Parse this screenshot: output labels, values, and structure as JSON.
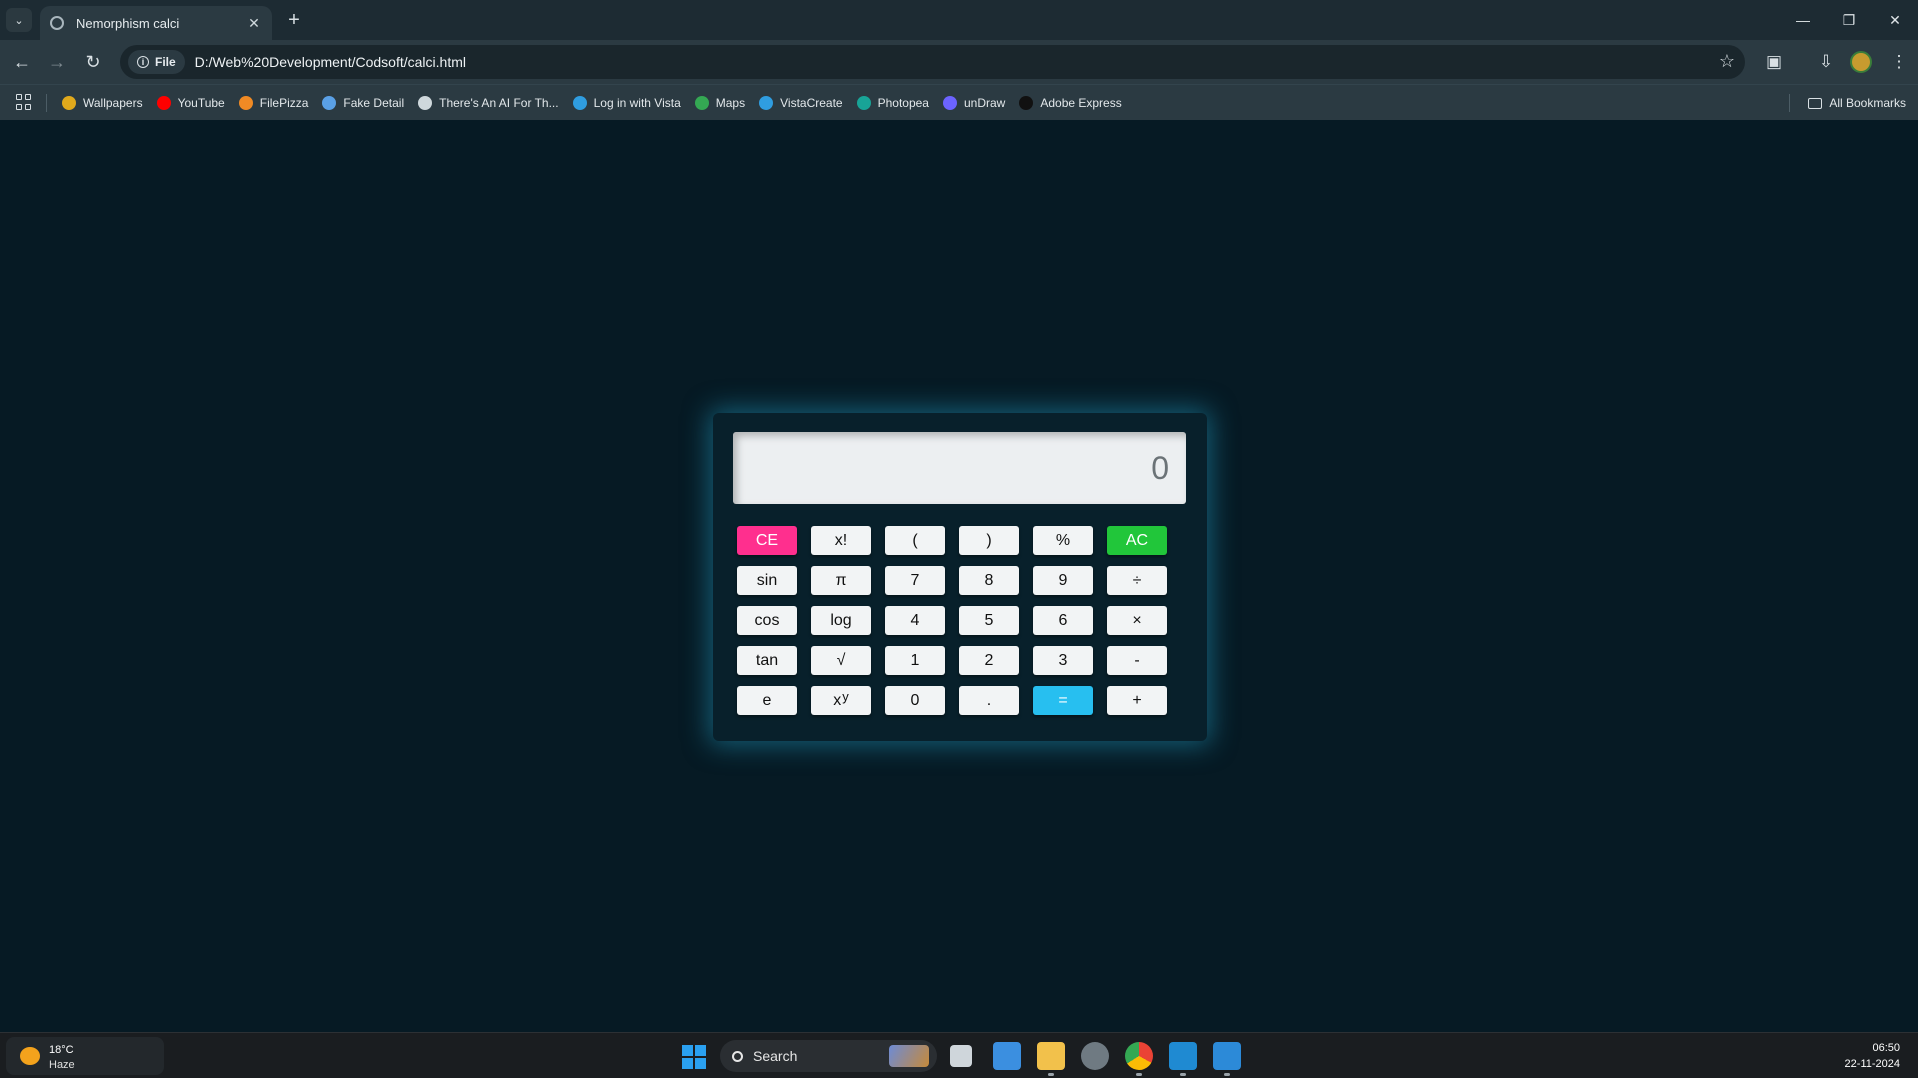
{
  "browser": {
    "tab_title": "Nemorphism calci",
    "omnibox_chip": "File",
    "url": "D:/Web%20Development/Codsoft/calci.html",
    "bookmarks": [
      {
        "label": "Wallpapers",
        "icon": "wallpapers-icon",
        "color": "#e0a91c"
      },
      {
        "label": "YouTube",
        "icon": "youtube-icon",
        "color": "#ff0000"
      },
      {
        "label": "FilePizza",
        "icon": "filepizza-icon",
        "color": "#f08a24"
      },
      {
        "label": "Fake Detail",
        "icon": "fake-detail-icon",
        "color": "#5aa0e6"
      },
      {
        "label": "There's An AI For Th...",
        "icon": "ai-icon",
        "color": "#cfd8dc"
      },
      {
        "label": "Log in with Vista",
        "icon": "vista-icon",
        "color": "#2f9de0"
      },
      {
        "label": "Maps",
        "icon": "maps-icon",
        "color": "#34a853"
      },
      {
        "label": "VistaCreate",
        "icon": "vistacreate-icon",
        "color": "#2f9de0"
      },
      {
        "label": "Photopea",
        "icon": "photopea-icon",
        "color": "#18a497"
      },
      {
        "label": "unDraw",
        "icon": "undraw-icon",
        "color": "#6c63ff"
      },
      {
        "label": "Adobe Express",
        "icon": "adobe-express-icon",
        "color": "#111111"
      }
    ],
    "all_bookmarks": "All Bookmarks"
  },
  "calculator": {
    "display": "0",
    "keys": [
      [
        "CE",
        "x!",
        "(",
        ")",
        "%",
        "AC"
      ],
      [
        "sin",
        "π",
        "7",
        "8",
        "9",
        "÷"
      ],
      [
        "cos",
        "log",
        "4",
        "5",
        "6",
        "×"
      ],
      [
        "tan",
        "√",
        "1",
        "2",
        "3",
        "-"
      ],
      [
        "e",
        "x",
        "0",
        ".",
        "=",
        "+"
      ]
    ],
    "power_sup": "y",
    "colors": {
      "ce": "#ff2f8e",
      "ac": "#21c63a",
      "equals": "#27bff0",
      "glow": "#2096b9"
    }
  },
  "taskbar": {
    "temperature": "18°C",
    "condition": "Haze",
    "search_placeholder": "Search",
    "time": "06:50",
    "date": "22-11-2024"
  }
}
